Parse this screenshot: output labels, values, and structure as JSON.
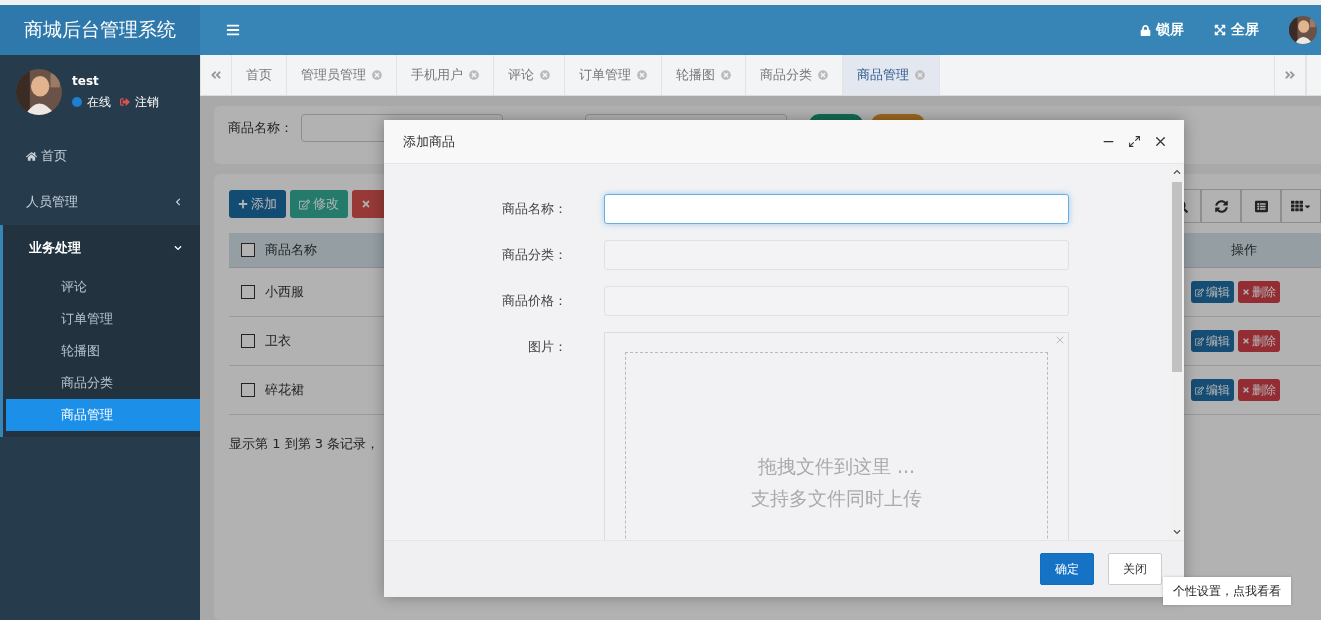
{
  "header": {
    "title": "商城后台管理系统",
    "actions": [
      {
        "label": "锁屏",
        "kind": "lock"
      },
      {
        "label": "全屏",
        "kind": "fullscreen"
      }
    ]
  },
  "user": {
    "name": "test",
    "status": "在线",
    "logout": "注销"
  },
  "sidebar": {
    "items": [
      {
        "label": "首页",
        "kind": "home"
      },
      {
        "label": "人员管理",
        "kind": "group",
        "expanded": false
      },
      {
        "label": "业务处理",
        "kind": "group",
        "expanded": true,
        "children": [
          {
            "label": "评论",
            "selected": false
          },
          {
            "label": "订单管理",
            "selected": false
          },
          {
            "label": "轮播图",
            "selected": false
          },
          {
            "label": "商品分类",
            "selected": false
          },
          {
            "label": "商品管理",
            "selected": true
          }
        ]
      }
    ]
  },
  "tabs": [
    {
      "label": "首页",
      "closable": false,
      "selected": false
    },
    {
      "label": "管理员管理",
      "closable": true,
      "selected": false
    },
    {
      "label": "手机用户",
      "closable": true,
      "selected": false
    },
    {
      "label": "评论",
      "closable": true,
      "selected": false
    },
    {
      "label": "订单管理",
      "closable": true,
      "selected": false
    },
    {
      "label": "轮播图",
      "closable": true,
      "selected": false
    },
    {
      "label": "商品分类",
      "closable": true,
      "selected": false
    },
    {
      "label": "商品管理",
      "closable": true,
      "selected": true
    }
  ],
  "search": {
    "label": "商品名称："
  },
  "toolbar": [
    {
      "label": "添加",
      "kind": "add"
    },
    {
      "label": "修改",
      "kind": "edit"
    },
    {
      "kind": "delete"
    }
  ],
  "table": {
    "all_checked": false,
    "columns": [
      "商品名称",
      "操作"
    ],
    "rows": [
      {
        "name": "小西服",
        "checked": false,
        "actions": [
          "编辑",
          "删除"
        ]
      },
      {
        "name": "卫衣",
        "checked": false,
        "actions": [
          "编辑",
          "删除"
        ]
      },
      {
        "name": "碎花裙",
        "checked": false,
        "actions": [
          "编辑",
          "删除"
        ]
      }
    ],
    "footer": "显示第 1 到第 3 条记录，"
  },
  "modal": {
    "title": "添加商品",
    "fields": [
      {
        "label": "商品名称：",
        "focused": true
      },
      {
        "label": "商品分类：",
        "focused": false
      },
      {
        "label": "商品价格：",
        "focused": false
      }
    ],
    "image": {
      "label": "图片：",
      "drop_text": "拖拽文件到这里 ...",
      "hint": "支持多文件同时上传"
    },
    "buttons": [
      {
        "label": "确定",
        "kind": "primary"
      },
      {
        "label": "关闭",
        "kind": "default"
      }
    ]
  },
  "tooltip": "个性设置，点我看看"
}
